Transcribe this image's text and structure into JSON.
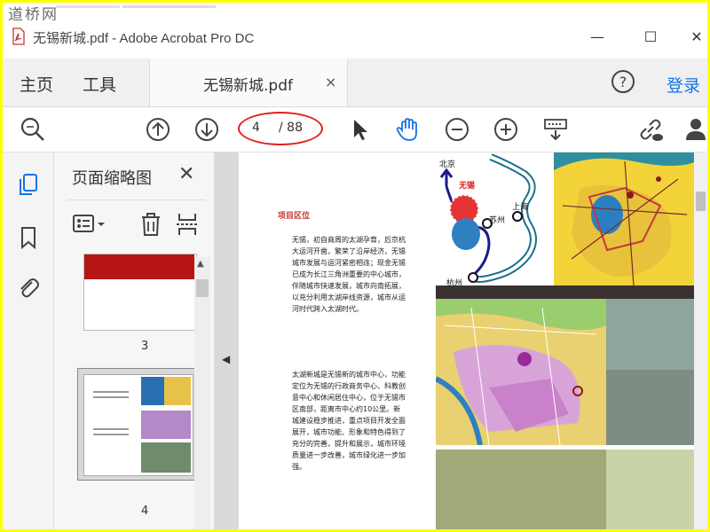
{
  "watermark": {
    "text": "道桥网"
  },
  "window": {
    "title": "无锡新城.pdf - Adobe Acrobat Pro DC",
    "minimize": "—",
    "maximize": "☐",
    "close": "✕"
  },
  "tabs": {
    "home": "主页",
    "tools": "工具",
    "document": "无锡新城.pdf",
    "close": "×",
    "login": "登录"
  },
  "toolbar": {
    "current_page": "4",
    "total_pages": "/ 88"
  },
  "thumbnails": {
    "title": "页面缩略图",
    "close": "✕",
    "items": [
      {
        "label": "3"
      },
      {
        "label": "4"
      }
    ]
  },
  "document": {
    "section_title": "项目区位",
    "para1": "无锡，初自商周的太湖孕育，后京杭大运河开凿，繁荣了沿岸经济，无锡城市发展与运河紧密相连；现金无锡已成为长江三角洲重要的中心城市，伴随城市快速发展，城市向南拓展，以充分利用太湖岸线资源，城市从运河时代跨入太湖时代。",
    "para2": "太湖新城是无锡新的城市中心，功能定位为无锡的行政商务中心、科教创意中心和休闲居住中心，位于无锡市区南部，距离市中心约10公里。新城建设稳步推进，重点项目开发全面展开，城市功能、形象和特色得到了充分的完善，提升和展示，城市环境质量进一步改善，城市绿化进一步加强。",
    "map_labels": {
      "beijing": "北京",
      "wuxi": "无锡",
      "suzhou": "苏州",
      "shanghai": "上海",
      "hangzhou": "杭州"
    }
  },
  "colors": {
    "accent": "#1473e6",
    "highlight": "#e02020",
    "border": "#ffff00"
  }
}
